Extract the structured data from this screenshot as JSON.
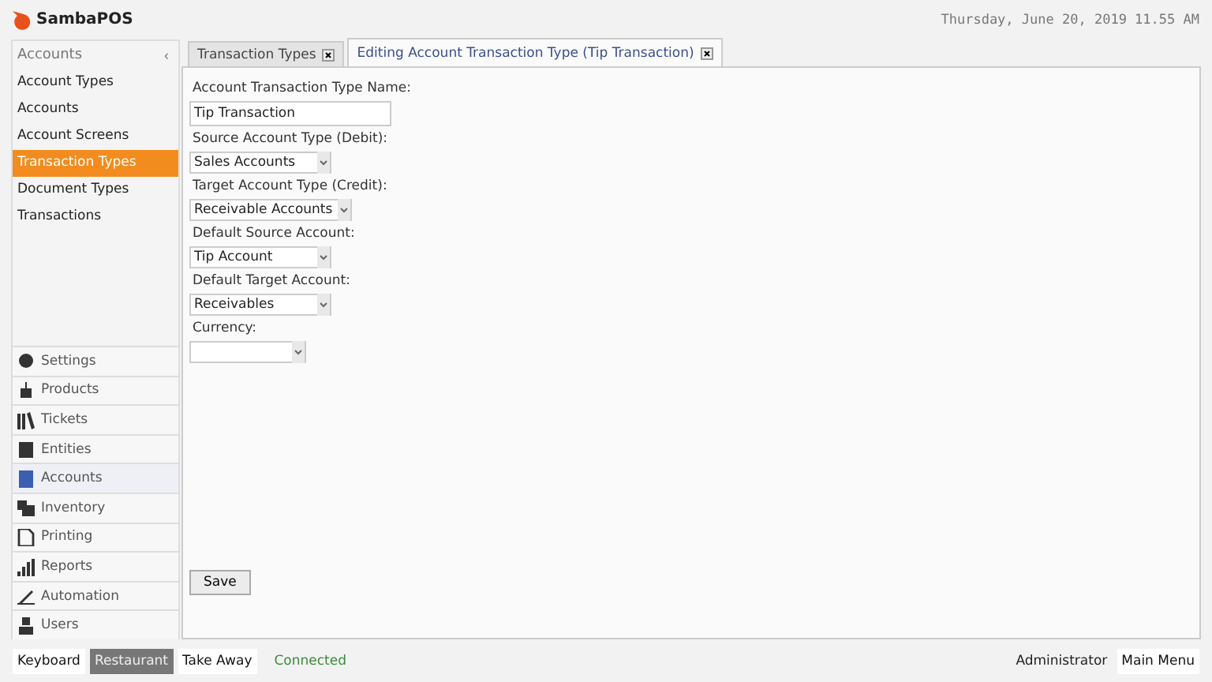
{
  "app": {
    "title": "SambaPOS",
    "datetime": "Thursday, June 20, 2019 11.55 AM"
  },
  "sidebar": {
    "title": "Accounts",
    "collapse": "‹",
    "items": [
      {
        "label": "Account Types",
        "selected": false
      },
      {
        "label": "Accounts",
        "selected": false
      },
      {
        "label": "Account Screens",
        "selected": false
      },
      {
        "label": "Transaction Types",
        "selected": true
      },
      {
        "label": "Document Types",
        "selected": false
      },
      {
        "label": "Transactions",
        "selected": false
      }
    ]
  },
  "nav": [
    {
      "label": "Settings",
      "selected": false
    },
    {
      "label": "Products",
      "selected": false
    },
    {
      "label": "Tickets",
      "selected": false
    },
    {
      "label": "Entities",
      "selected": false
    },
    {
      "label": "Accounts",
      "selected": true
    },
    {
      "label": "Inventory",
      "selected": false
    },
    {
      "label": "Printing",
      "selected": false
    },
    {
      "label": "Reports",
      "selected": false
    },
    {
      "label": "Automation",
      "selected": false
    },
    {
      "label": "Users",
      "selected": false
    }
  ],
  "tabs": [
    {
      "label": "Transaction Types",
      "selected": false
    },
    {
      "label": "Editing Account Transaction Type (Tip Transaction)",
      "selected": true
    }
  ],
  "form": {
    "fields": [
      {
        "kind": "text",
        "label": "Account Transaction Type Name:",
        "value": "Tip Transaction"
      },
      {
        "kind": "dropdown",
        "label": "Source Account Type (Debit):",
        "value": "Sales Accounts"
      },
      {
        "kind": "dropdown",
        "label": "Target Account Type (Credit):",
        "value": "Receivable Accounts"
      },
      {
        "kind": "dropdown",
        "label": "Default Source Account:",
        "value": "Tip Account"
      },
      {
        "kind": "dropdown",
        "label": "Default Target Account:",
        "value": "Receivables"
      },
      {
        "kind": "dropdown",
        "label": "Currency:"
      }
    ],
    "save": "Save"
  },
  "status_bar": {
    "modes": [
      {
        "label": "Keyboard",
        "selected": false
      },
      {
        "label": "Restaurant",
        "selected": true
      },
      {
        "label": "Take Away",
        "selected": false
      }
    ],
    "connection": "Connected",
    "user": "Administrator",
    "menu": "Main Menu"
  }
}
